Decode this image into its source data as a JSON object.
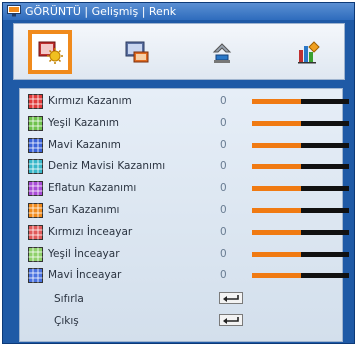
{
  "header": {
    "title": "GÖRÜNTÜ | Gelişmiş | Renk",
    "icon": "display-icon"
  },
  "menu_icons": [
    {
      "name": "image-settings-icon",
      "selected": true
    },
    {
      "name": "display-settings-icon",
      "selected": false
    },
    {
      "name": "setup-icon",
      "selected": false
    },
    {
      "name": "options-icon",
      "selected": false
    }
  ],
  "colors": {
    "background": "#1f5aa6",
    "accent": "#f07a12",
    "selection": "#f08a1c"
  },
  "rows": [
    {
      "label": "Kırmızı Kazanım",
      "value": "0",
      "level": 0.5,
      "swatch": "#e03a3a"
    },
    {
      "label": "Yeşil Kazanım",
      "value": "0",
      "level": 0.5,
      "swatch": "#6fc24c"
    },
    {
      "label": "Mavi Kazanım",
      "value": "0",
      "level": 0.5,
      "swatch": "#3a62d8"
    },
    {
      "label": "Deniz Mavisi Kazanımı",
      "value": "0",
      "level": 0.5,
      "swatch": "#38b7c9"
    },
    {
      "label": "Eflatun Kazanımı",
      "value": "0",
      "level": 0.5,
      "swatch": "#a84bd6"
    },
    {
      "label": "Sarı Kazanımı",
      "value": "0",
      "level": 0.5,
      "swatch": "#f08a1c"
    },
    {
      "label": "Kırmızı İnceayar",
      "value": "0",
      "level": 0.5,
      "swatch": "#e05a5a"
    },
    {
      "label": "Yeşil İnceayar",
      "value": "0",
      "level": 0.5,
      "swatch": "#8fd06a"
    },
    {
      "label": "Mavi İnceayar",
      "value": "0",
      "level": 0.5,
      "swatch": "#4a72e0"
    }
  ],
  "actions": [
    {
      "label": "Sıfırla",
      "icon": "enter-icon"
    },
    {
      "label": "Çıkış",
      "icon": "enter-icon"
    }
  ]
}
